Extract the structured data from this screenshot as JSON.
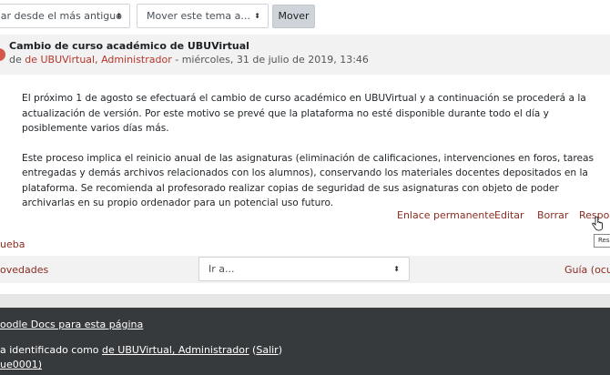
{
  "controls": {
    "sort_value": "enar desde el más antiguo",
    "move_value": "Mover este tema a...",
    "move_button": "Mover"
  },
  "post": {
    "subject": "Cambio de curso académico de UBUVirtual",
    "byline_prefix": "de",
    "author": "de UBUVirtual, Administrador",
    "byline_suffix": "- miércoles, 31 de julio de 2019, 13:46",
    "paragraph_1": "El próximo 1 de agosto se efectuará el cambio de curso académico en UBUVirtual y a continuación se procederá a la actualización de versión. Por este motivo se prevé que la plataforma no esté disponible durante todo el día y posiblemente varios días más.",
    "paragraph_2": "Este proceso implica el reinicio anual de las asignaturas (eliminación de calificaciones, intervenciones en foros, tareas entregadas y demás archivos relacionados con los alumnos), conservando los materiales docentes depositados en la plataforma. Se recomienda al profesorado realizar copias de seguridad de sus asignaturas con objeto de poder archivarlas en su propio ordenador para un potencial uso futuro."
  },
  "actions": {
    "permalink": "Enlace permanente",
    "edit": "Editar",
    "delete": "Borrar",
    "reply": "Respo",
    "tooltip": "Res"
  },
  "navigation": {
    "prev_thread": "ueba",
    "news": "ovedades",
    "jump_to": "Ir a...",
    "guide": "Guía (ocult"
  },
  "footer": {
    "docs": "oodle Docs para esta página",
    "login_prefix": "a identificado como",
    "login_user": "de UBUVirtual, Administrador",
    "logout_open": "(",
    "logout": "Salir",
    "logout_close": ")",
    "user_extra": "ue0001)"
  },
  "colors": {
    "link": "#8b2c22",
    "header_bg": "#f2f2f2",
    "footer_bg": "#373a3c"
  }
}
